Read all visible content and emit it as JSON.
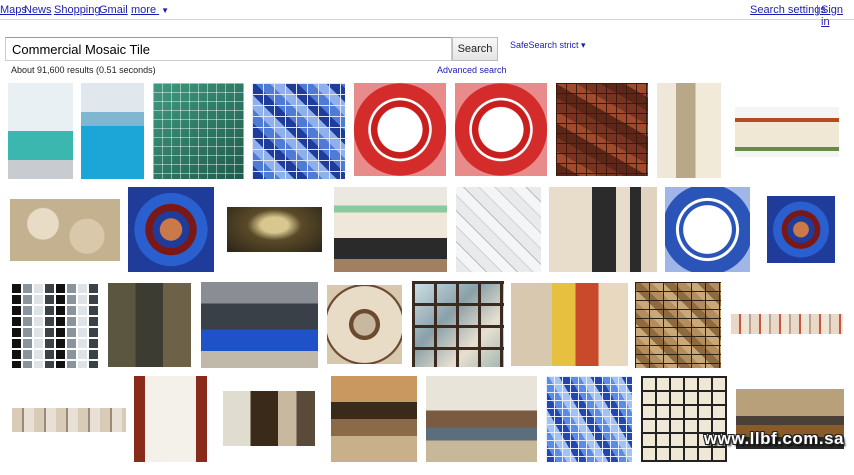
{
  "topbar": {
    "links": [
      "Maps",
      "News",
      "Shopping",
      "Gmail"
    ],
    "more_label": "more",
    "more_arrow": "▼",
    "right_links": [
      "Search settings",
      "Sign in"
    ],
    "separator": "|"
  },
  "search": {
    "query": "Commercial Mosaic Tile",
    "button_label": "Search",
    "safesearch_label": "SafeSearch strict ▾",
    "results_text": "About 91,600 results (0.51 seconds)",
    "advanced_label": "Advanced search"
  },
  "watermark": "www.llbf.com.sa",
  "colors": {
    "link": "#1c1cb4",
    "topbar_border": "#c9d7f1"
  }
}
